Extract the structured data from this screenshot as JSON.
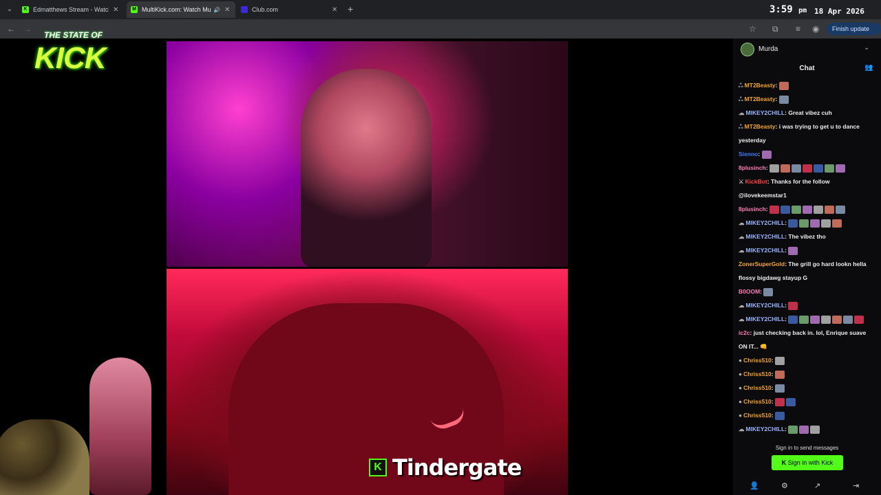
{
  "browser": {
    "tabs": [
      {
        "title": "Edmatthews Stream - Watch Li",
        "favicon": "kick-icon",
        "color": "#53fc18",
        "active": false
      },
      {
        "title": "MultiKick.com: Watch Multi",
        "favicon": "multikick-icon",
        "color": "#53fc18",
        "active": true
      },
      {
        "title": "Club.com",
        "favicon": "club-icon",
        "color": "#3b2bd6",
        "active": false
      }
    ],
    "new_tab": "+",
    "finish_update": "Finish update",
    "clock_time": "3:59",
    "clock_ampm": "pm",
    "clock_date": "18 Apr 2026"
  },
  "overlay": {
    "logo_line1": "THE STATE OF",
    "logo_line2": "KICK",
    "caption": "Tindergate",
    "caption_icon": "K"
  },
  "chat": {
    "channel": "Murda",
    "title": "Chat",
    "messages": [
      {
        "user": "MT2Beasty",
        "color": "#f5a623",
        "text": "",
        "badge": "ஃ",
        "emotes": 1
      },
      {
        "user": "MT2Beasty",
        "color": "#f5a623",
        "text": "",
        "badge": "ஃ",
        "emotes": 1
      },
      {
        "user": "MIKEY2CHILL",
        "color": "#9ab4ff",
        "text": "Great vibez cuh",
        "badge": "☁",
        "emotes": 0
      },
      {
        "user": "MT2Beasty",
        "color": "#f5a623",
        "text": "i was trying to get u to dance",
        "badge": "ஃ",
        "emotes": 0
      },
      {
        "user": "",
        "color": "#eee",
        "text": "yesterday",
        "badge": "",
        "emotes": 0
      },
      {
        "user": "Sienno",
        "color": "#3b7cff",
        "text": "",
        "badge": "",
        "emotes": 1
      },
      {
        "user": "8plusinch",
        "color": "#ff7ab6",
        "text": "",
        "badge": "",
        "emotes": 7
      },
      {
        "user": "KickBot",
        "color": "#ff4040",
        "text": "Thanks for the follow",
        "badge": "⚔",
        "emotes": 0
      },
      {
        "user": "",
        "color": "#eee",
        "text": "@ilovekeemstar1",
        "badge": "",
        "emotes": 0
      },
      {
        "user": "8plusinch",
        "color": "#ff7ab6",
        "text": "",
        "badge": "",
        "emotes": 7
      },
      {
        "user": "MIKEY2CHILL",
        "color": "#9ab4ff",
        "text": "",
        "badge": "☁",
        "emotes": 5
      },
      {
        "user": "MIKEY2CHILL",
        "color": "#9ab4ff",
        "text": "The vibez tho",
        "badge": "☁",
        "emotes": 0
      },
      {
        "user": "MIKEY2CHILL",
        "color": "#9ab4ff",
        "text": "",
        "badge": "☁",
        "emotes": 1
      },
      {
        "user": "ZonerSuperGold",
        "color": "#f5a623",
        "text": "The grill go hard lookn hella",
        "badge": "",
        "emotes": 0
      },
      {
        "user": "",
        "color": "#eee",
        "text": "flossy bigdawg stayup G",
        "badge": "",
        "emotes": 0
      },
      {
        "user": "B0OOM",
        "color": "#ff7ab6",
        "text": "",
        "badge": "",
        "emotes": 1
      },
      {
        "user": "MIKEY2CHILL",
        "color": "#9ab4ff",
        "text": "",
        "badge": "☁",
        "emotes": 1
      },
      {
        "user": "MIKEY2CHILL",
        "color": "#9ab4ff",
        "text": "",
        "badge": "☁",
        "emotes": 7
      },
      {
        "user": "ic2c",
        "color": "#ff7ab6",
        "text": "just checking back in. lol, Enrique suave",
        "badge": "",
        "emotes": 0
      },
      {
        "user": "",
        "color": "#eee",
        "text": "ON IT... 👊",
        "badge": "",
        "emotes": 0
      },
      {
        "user": "Chriss510",
        "color": "#f5a623",
        "text": "",
        "badge": "●",
        "emotes": 1
      },
      {
        "user": "Chriss510",
        "color": "#f5a623",
        "text": "",
        "badge": "●",
        "emotes": 1
      },
      {
        "user": "Chriss510",
        "color": "#f5a623",
        "text": "",
        "badge": "●",
        "emotes": 1
      },
      {
        "user": "Chriss510",
        "color": "#f5a623",
        "text": "",
        "badge": "●",
        "emotes": 2
      },
      {
        "user": "Chriss510",
        "color": "#f5a623",
        "text": "",
        "badge": "●",
        "emotes": 1
      },
      {
        "user": "MIKEY2CHILL",
        "color": "#9ab4ff",
        "text": "",
        "badge": "☁",
        "emotes": 3
      }
    ],
    "signin_prompt": "Sign in to send messages",
    "signin_button": "Sign in with Kick",
    "accent": "#53fc18"
  }
}
